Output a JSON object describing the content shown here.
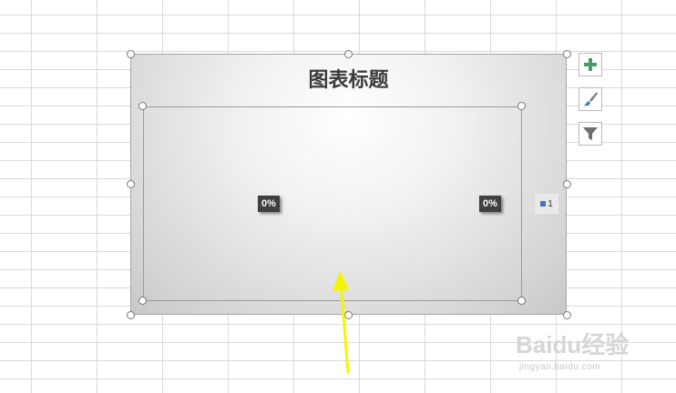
{
  "chart": {
    "title": "图表标题",
    "data_labels": [
      "0%",
      "0%"
    ],
    "legend": {
      "entry": "1",
      "swatch_color": "#4472c4"
    }
  },
  "chart_data": {
    "type": "pie",
    "title": "图表标题",
    "series": [
      {
        "name": "1",
        "values": [
          0,
          0
        ]
      }
    ],
    "data_labels": [
      "0%",
      "0%"
    ],
    "legend": "right"
  },
  "chart_tools": [
    {
      "name": "chart-elements",
      "icon": "plus-icon"
    },
    {
      "name": "chart-styles",
      "icon": "paintbrush-icon"
    },
    {
      "name": "chart-filters",
      "icon": "funnel-icon"
    }
  ],
  "watermark": {
    "logo_text": "Baidu经验",
    "url": "jingyan.baidu.com"
  }
}
